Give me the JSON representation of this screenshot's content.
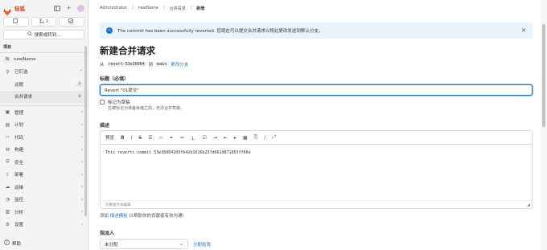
{
  "brand": {
    "name": "轻狐",
    "accent": "#e24329"
  },
  "sidebar": {
    "counters": [
      {
        "icon": "issues-icon",
        "value": ""
      },
      {
        "icon": "merge-request-icon",
        "value": "1"
      },
      {
        "icon": "todo-icon",
        "value": ""
      }
    ],
    "search_label": "搜索或转到...",
    "section_label": "项目",
    "project": {
      "initial": "N",
      "name": "newName"
    },
    "pinned": {
      "label": "已钉选",
      "items": [
        {
          "label": "议题",
          "count": "1"
        },
        {
          "label": "合并请求",
          "count": "0"
        }
      ]
    },
    "items": [
      {
        "label": "管理",
        "icon": "manage-icon"
      },
      {
        "label": "计划",
        "icon": "plan-icon"
      },
      {
        "label": "代码",
        "icon": "code-icon"
      },
      {
        "label": "构建",
        "icon": "build-icon"
      },
      {
        "label": "安全",
        "icon": "shield-icon"
      },
      {
        "label": "部署",
        "icon": "deploy-icon"
      },
      {
        "label": "运维",
        "icon": "operate-icon"
      },
      {
        "label": "监控",
        "icon": "monitor-icon"
      },
      {
        "label": "分析",
        "icon": "analytics-icon"
      },
      {
        "label": "设置",
        "icon": "gear-icon"
      }
    ],
    "help_label": "帮助"
  },
  "breadcrumb": [
    "Administrator",
    "newName",
    "合并请求",
    "新增"
  ],
  "alert": {
    "text": "The commit has been successfully reverted. 您现在可以提交合并请求以将此更改发送到默认分支。",
    "accent": "#1f75cb"
  },
  "page": {
    "title": "新建合并请求",
    "branch_from_prefix": "从",
    "source_branch": "revert-53e36004",
    "branch_into": "到",
    "target_branch": "main",
    "change_branches": "更改分支"
  },
  "form": {
    "title_label": "标题（必填）",
    "title_value": "Revert \"01提交\"",
    "draft_label": "标记为草稿",
    "draft_help": "在被标记为准备就绪之前，无法合并草稿。",
    "description_label": "描述",
    "preview_tab": "预览",
    "description_text": "This reverts commit 53e36004103fb42b1616b237d661d871853ff66e",
    "editor_footer": "切换富文本编辑",
    "template_prefix": "添加",
    "template_link": "描述模板",
    "template_suffix": "以帮助你的贡献者有效沟通!",
    "assignee_label": "指派人",
    "assignee_value": "未分配",
    "assign_me": "分配给我"
  }
}
